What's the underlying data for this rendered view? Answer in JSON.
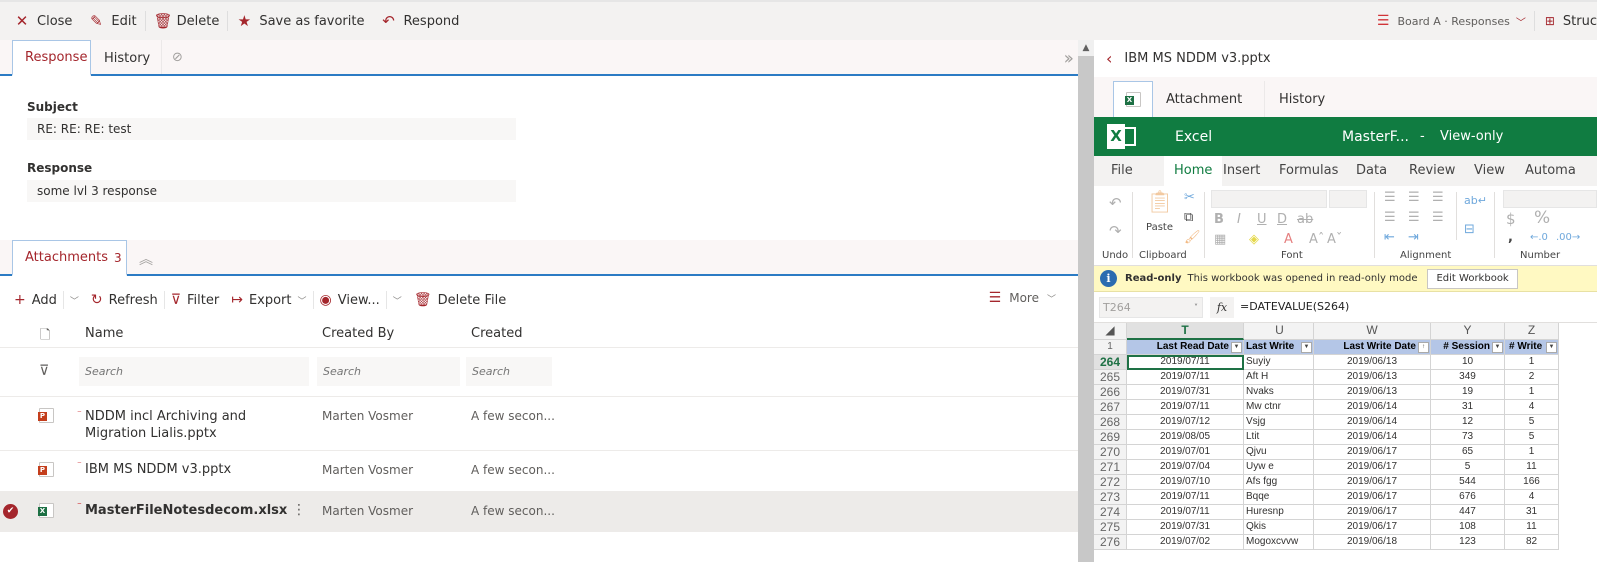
{
  "toolbar": {
    "close": "Close",
    "edit": "Edit",
    "delete": "Delete",
    "favorite": "Save as favorite",
    "respond": "Respond",
    "board": "Board A · Responses",
    "structure": "Struc"
  },
  "detail_tabs": {
    "response": "Response",
    "history": "History"
  },
  "fields": {
    "subject_label": "Subject",
    "subject_value": "RE: RE: RE: test",
    "response_label": "Response",
    "response_value": "some lvl 3 response"
  },
  "attachments": {
    "tab_label": "Attachments",
    "count": "3",
    "commands": {
      "add": "Add",
      "refresh": "Refresh",
      "filter": "Filter",
      "export": "Export",
      "view": "View...",
      "delete_file": "Delete File",
      "more": "More"
    },
    "columns": {
      "name": "Name",
      "created_by": "Created By",
      "created": "Created"
    },
    "search_placeholder": "Search",
    "rows": [
      {
        "name_line1": "NDDM incl Archiving and",
        "name_line2": "Migration Lialis.pptx",
        "type": "pptx",
        "created_by": "Marten Vosmer",
        "created": "A few secon...",
        "selected": false
      },
      {
        "name_line1": "IBM MS NDDM v3.pptx",
        "name_line2": "",
        "type": "pptx",
        "created_by": "Marten Vosmer",
        "created": "A few secon...",
        "selected": false
      },
      {
        "name_line1": "MasterFileNotesdecom.xlsx",
        "name_line2": "",
        "type": "xlsx",
        "created_by": "Marten Vosmer",
        "created": "A few secon...",
        "selected": true
      }
    ]
  },
  "preview": {
    "title": "IBM MS NDDM v3.pptx",
    "tabs": {
      "attachment": "Attachment",
      "history": "History"
    },
    "excel": {
      "app": "Excel",
      "file": "MasterF...",
      "sep": "-",
      "mode": "View-only",
      "menu": [
        "File",
        "Home",
        "Insert",
        "Formulas",
        "Data",
        "Review",
        "View",
        "Automa"
      ],
      "active_menu": "Home",
      "ribbon_groups": {
        "undo": "Undo",
        "clipboard": "Clipboard",
        "paste": "Paste",
        "font": "Font",
        "alignment": "Alignment",
        "number": "Number"
      },
      "info_title": "Read-only",
      "info_text": "This workbook was opened in read-only mode",
      "edit_button": "Edit Workbook",
      "name_box": "T264",
      "fx": "fx",
      "formula": "=DATEVALUE(S264)",
      "col_letters": [
        "T",
        "U",
        "W",
        "Y",
        "Z"
      ],
      "header_row_num": "1",
      "headers": [
        "Last Read Date",
        "Last Write",
        "Last Write Date",
        "# Session",
        "# Write"
      ],
      "rows": [
        {
          "n": "264",
          "t": "2019/07/11",
          "u": "Suyiy",
          "w": "2019/06/13",
          "y": "10",
          "z": "1"
        },
        {
          "n": "265",
          "t": "2019/07/11",
          "u": "Aft H",
          "w": "2019/06/13",
          "y": "349",
          "z": "2"
        },
        {
          "n": "266",
          "t": "2019/07/31",
          "u": "Nvaks",
          "w": "2019/06/13",
          "y": "19",
          "z": "1"
        },
        {
          "n": "267",
          "t": "2019/07/11",
          "u": "Mw ctnr",
          "w": "2019/06/14",
          "y": "31",
          "z": "4"
        },
        {
          "n": "268",
          "t": "2019/07/12",
          "u": "Vsjg",
          "w": "2019/06/14",
          "y": "12",
          "z": "5"
        },
        {
          "n": "269",
          "t": "2019/08/05",
          "u": "Ltit",
          "w": "2019/06/14",
          "y": "73",
          "z": "5"
        },
        {
          "n": "270",
          "t": "2019/07/01",
          "u": "Qjvu",
          "w": "2019/06/17",
          "y": "65",
          "z": "1"
        },
        {
          "n": "271",
          "t": "2019/07/04",
          "u": "Uyw e",
          "w": "2019/06/17",
          "y": "5",
          "z": "11"
        },
        {
          "n": "272",
          "t": "2019/07/10",
          "u": "Afs fgg",
          "w": "2019/06/17",
          "y": "544",
          "z": "166"
        },
        {
          "n": "273",
          "t": "2019/07/11",
          "u": "Bqqe",
          "w": "2019/06/17",
          "y": "676",
          "z": "4"
        },
        {
          "n": "274",
          "t": "2019/07/11",
          "u": "Huresnp",
          "w": "2019/06/17",
          "y": "447",
          "z": "31"
        },
        {
          "n": "275",
          "t": "2019/07/31",
          "u": "Qkis",
          "w": "2019/06/17",
          "y": "108",
          "z": "11"
        },
        {
          "n": "276",
          "t": "2019/07/02",
          "u": "Mogoxcvvw",
          "w": "2019/06/18",
          "y": "123",
          "z": "82"
        }
      ]
    }
  }
}
